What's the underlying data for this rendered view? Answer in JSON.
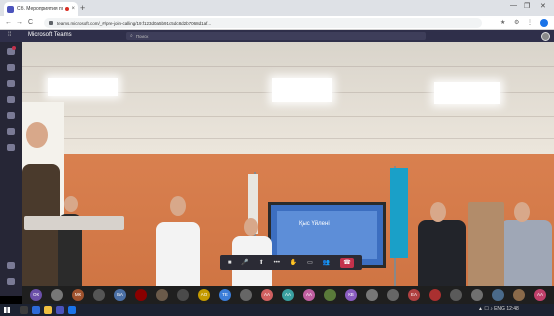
{
  "browser": {
    "tab_title": "Сб. Мероприятия по Собранию...",
    "tab_close": "×",
    "new_tab": "+",
    "url": "teams.microsoft.com/_#/pre-join-calling/19:f123d0a5b91c5dc8d2b7068d1af...",
    "window_controls": [
      "—",
      "❐",
      "✕"
    ],
    "nav": [
      "←",
      "→",
      "C"
    ]
  },
  "teams": {
    "app_name": "Microsoft Teams",
    "search_placeholder": "Поиск"
  },
  "stage": {
    "screen_text": "Қыс Үйлені"
  },
  "call_controls": [
    {
      "name": "camera-icon",
      "glyph": "■"
    },
    {
      "name": "mic-icon",
      "glyph": "🎤"
    },
    {
      "name": "share-icon",
      "glyph": "⬆"
    },
    {
      "name": "more-icon",
      "glyph": "•••"
    },
    {
      "name": "raise-hand-icon",
      "glyph": "✋"
    },
    {
      "name": "chat-icon",
      "glyph": "▭"
    },
    {
      "name": "participants-icon",
      "glyph": "👥"
    }
  ],
  "hangup_glyph": "☎",
  "participants": [
    {
      "initials": "ОК",
      "color": "#6b4fa8"
    },
    {
      "initials": "",
      "color": "#777777"
    },
    {
      "initials": "МК",
      "color": "#a0522d"
    },
    {
      "initials": "",
      "color": "#555555"
    },
    {
      "initials": "БА",
      "color": "#4a6fa5"
    },
    {
      "initials": "",
      "color": "#8b0000"
    },
    {
      "initials": "",
      "color": "#6a5a4a"
    },
    {
      "initials": "",
      "color": "#4a4a4a"
    },
    {
      "initials": "АО",
      "color": "#c49a00"
    },
    {
      "initials": "ТЕ",
      "color": "#3b7dd8"
    },
    {
      "initials": "",
      "color": "#666666"
    },
    {
      "initials": "АА",
      "color": "#d06060"
    },
    {
      "initials": "АА",
      "color": "#3aa0a0"
    },
    {
      "initials": "АА",
      "color": "#c05fa0"
    },
    {
      "initials": "",
      "color": "#5a7a3a"
    },
    {
      "initials": "КВ",
      "color": "#8a5cc0"
    },
    {
      "initials": "",
      "color": "#777777"
    },
    {
      "initials": "",
      "color": "#666666"
    },
    {
      "initials": "ЕА",
      "color": "#b04040"
    },
    {
      "initials": "",
      "color": "#aa3030"
    },
    {
      "initials": "",
      "color": "#5a5a5a"
    },
    {
      "initials": "",
      "color": "#707070"
    },
    {
      "initials": "",
      "color": "#4a6a8a"
    },
    {
      "initials": "",
      "color": "#8a6a4a"
    },
    {
      "initials": "АА",
      "color": "#c0406a"
    }
  ],
  "taskbar": {
    "tray_text": "▲ ☐ ♪ ENG 12:48"
  }
}
